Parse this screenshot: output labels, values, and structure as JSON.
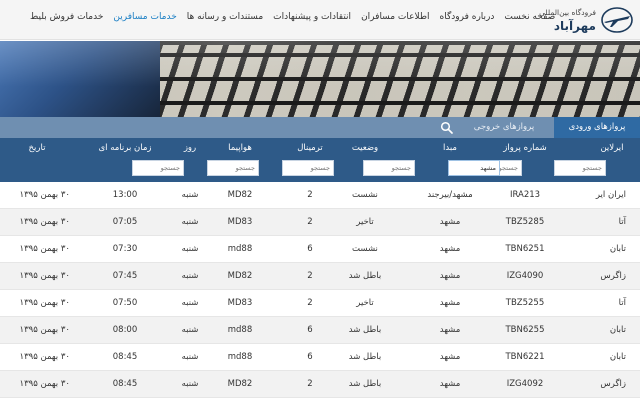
{
  "brand": {
    "small": "فرودگاه بین‌المللی",
    "big": "مهرآباد"
  },
  "nav": [
    {
      "label": "صفحه نخست",
      "active": false
    },
    {
      "label": "درباره فرودگاه",
      "active": false
    },
    {
      "label": "اطلاعات مسافران",
      "active": false
    },
    {
      "label": "انتقادات و پیشنهادات",
      "active": false
    },
    {
      "label": "مستندات و رسانه ها",
      "active": false
    },
    {
      "label": "خدمات مسافرین",
      "active": true
    },
    {
      "label": "خدمات فروش بلیط",
      "active": false
    }
  ],
  "tabs": {
    "arrivals": "پروازهای ورودی داخلی",
    "departures": "پروازهای خروجی داخلی"
  },
  "columns": {
    "airline": "ایرلاین",
    "flight": "شماره پرواز",
    "origin": "مبدا",
    "status": "وضعیت",
    "terminal": "ترمینال",
    "plane": "هواپیما",
    "day": "روز",
    "time": "زمان برنامه ای",
    "date": "تاریخ"
  },
  "filters": {
    "placeholder": "جستجو",
    "origin_value": "مشهد"
  },
  "rows": [
    {
      "airline": "ایران ایر",
      "flight": "IRA213",
      "origin": "مشهد/بیرجند",
      "status": "نشست",
      "terminal": "2",
      "plane": "MD82",
      "day": "شنبه",
      "time": "13:00",
      "date": "۳۰ بهمن ۱۳۹۵"
    },
    {
      "airline": "آتا",
      "flight": "TBZ5285",
      "origin": "مشهد",
      "status": "تاخیر",
      "terminal": "2",
      "plane": "MD83",
      "day": "شنبه",
      "time": "07:05",
      "date": "۳۰ بهمن ۱۳۹۵"
    },
    {
      "airline": "تابان",
      "flight": "TBN6251",
      "origin": "مشهد",
      "status": "نشست",
      "terminal": "6",
      "plane": "md88",
      "day": "شنبه",
      "time": "07:30",
      "date": "۳۰ بهمن ۱۳۹۵"
    },
    {
      "airline": "زاگرس",
      "flight": "IZG4090",
      "origin": "مشهد",
      "status": "باطل شد",
      "terminal": "2",
      "plane": "MD82",
      "day": "شنبه",
      "time": "07:45",
      "date": "۳۰ بهمن ۱۳۹۵"
    },
    {
      "airline": "آتا",
      "flight": "TBZ5255",
      "origin": "مشهد",
      "status": "تاخیر",
      "terminal": "2",
      "plane": "MD83",
      "day": "شنبه",
      "time": "07:50",
      "date": "۳۰ بهمن ۱۳۹۵"
    },
    {
      "airline": "تابان",
      "flight": "TBN6255",
      "origin": "مشهد",
      "status": "باطل شد",
      "terminal": "6",
      "plane": "md88",
      "day": "شنبه",
      "time": "08:00",
      "date": "۳۰ بهمن ۱۳۹۵"
    },
    {
      "airline": "تابان",
      "flight": "TBN6221",
      "origin": "مشهد",
      "status": "باطل شد",
      "terminal": "6",
      "plane": "md88",
      "day": "شنبه",
      "time": "08:45",
      "date": "۳۰ بهمن ۱۳۹۵"
    },
    {
      "airline": "زاگرس",
      "flight": "IZG4092",
      "origin": "مشهد",
      "status": "باطل شد",
      "terminal": "2",
      "plane": "MD82",
      "day": "شنبه",
      "time": "08:45",
      "date": "۳۰ بهمن ۱۳۹۵"
    }
  ]
}
